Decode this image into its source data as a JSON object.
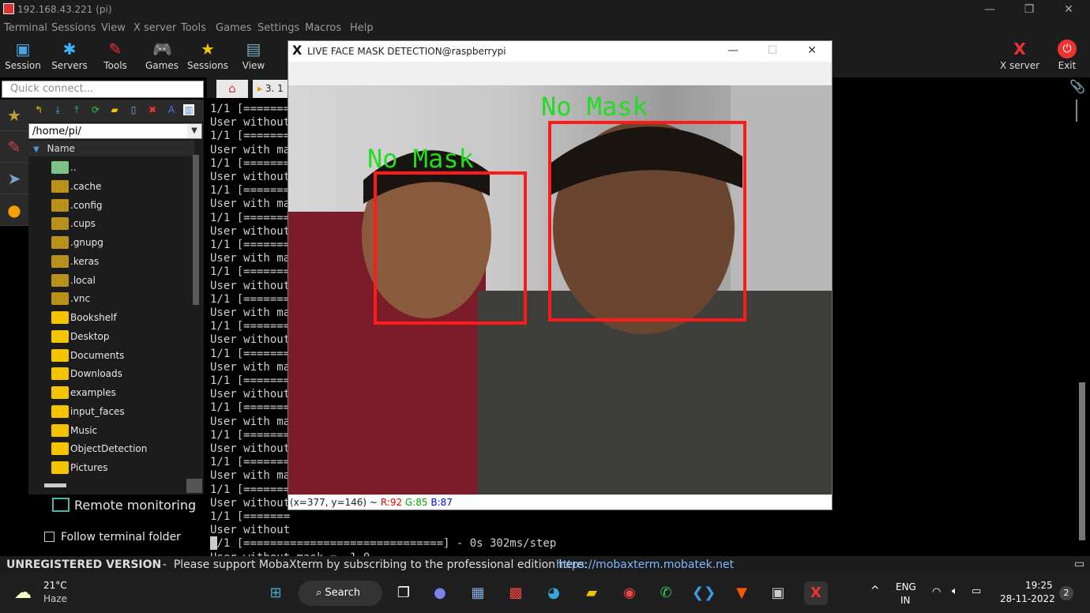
{
  "window": {
    "title": "192.168.43.221 (pi)"
  },
  "menu": [
    "Terminal",
    "Sessions",
    "View",
    "X server",
    "Tools",
    "Games",
    "Settings",
    "Macros",
    "Help"
  ],
  "toolbar": {
    "session": "Session",
    "servers": "Servers",
    "tools": "Tools",
    "games": "Games",
    "sessions": "Sessions",
    "view": "View",
    "xserver": "X server",
    "exit": "Exit"
  },
  "quick_connect": {
    "placeholder": "Quick connect..."
  },
  "tab": {
    "label": "3. 1"
  },
  "filebrowser": {
    "path": "/home/pi/",
    "name_header": "Name",
    "items": [
      "..",
      ".cache",
      ".config",
      ".cups",
      ".gnupg",
      ".keras",
      ".local",
      ".vnc",
      "Bookshelf",
      "Desktop",
      "Documents",
      "Downloads",
      "examples",
      "input_faces",
      "Music",
      "ObjectDetection",
      "Pictures"
    ]
  },
  "remote_monitoring": "Remote monitoring",
  "follow_folder": "Follow terminal folder",
  "terminal": {
    "lines": [
      "1/1 [=======",
      "User without",
      "1/1 [=======",
      "User with ma",
      "1/1 [=======",
      "User without",
      "1/1 [=======",
      "User with ma",
      "1/1 [=======",
      "User without",
      "1/1 [=======",
      "User with ma",
      "1/1 [=======",
      "User without",
      "1/1 [=======",
      "User with ma",
      "1/1 [=======",
      "User without",
      "1/1 [=======",
      "User with ma",
      "1/1 [=======",
      "User without",
      "1/1 [=======",
      "User with ma",
      "1/1 [=======",
      "User without",
      "1/1 [=======",
      "User with ma",
      "1/1 [=======",
      "User without",
      "1/1 [=======",
      "User without",
      "1/1 [==============================] - 0s 302ms/step",
      "User without mask =  1.0"
    ]
  },
  "xwindow": {
    "title": "LIVE FACE MASK DETECTION@raspberrypi",
    "label1": "No Mask",
    "label2": "No Mask",
    "coords": "(x=377, y=146) ~",
    "r": "R:92",
    "g": "G:85",
    "b": "B:87"
  },
  "status": {
    "unregistered": "UNREGISTERED VERSION",
    "support": "  -  Please support MobaXterm by subscribing to the professional edition here:  ",
    "link": "https://mobaxterm.mobatek.net"
  },
  "taskbar": {
    "temp": "21°C",
    "weather": "Haze",
    "search": "Search",
    "lang1": "ENG",
    "lang2": "IN",
    "time": "19:25",
    "date": "28-11-2022",
    "notif": "2"
  },
  "colors": {
    "box": "#ff1a1a",
    "label": "#22dd22"
  }
}
